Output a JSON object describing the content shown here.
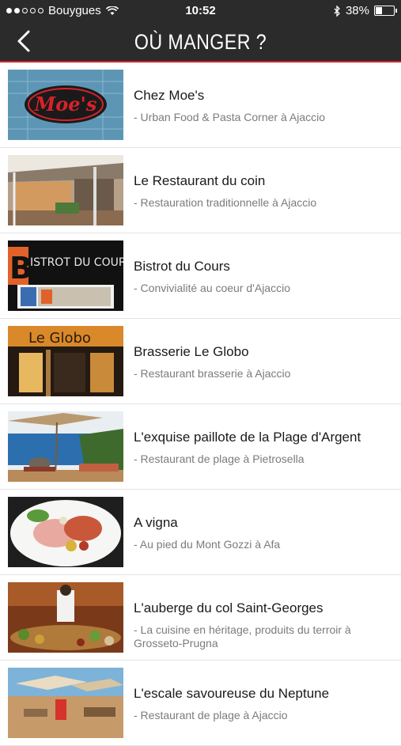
{
  "status": {
    "carrier": "Bouygues",
    "time": "10:52",
    "battery": "38%",
    "battery_level": 0.38
  },
  "nav": {
    "title": "OÙ MANGER ?",
    "back_icon": "chevron-left-icon"
  },
  "restaurants": [
    {
      "name": "Chez Moe's",
      "subtitle": " - Urban Food & Pasta Corner à Ajaccio",
      "logo_text": "Moe's"
    },
    {
      "name": "Le Restaurant du coin",
      "subtitle": " - Restauration traditionnelle à Ajaccio"
    },
    {
      "name": "Bistrot du Cours",
      "subtitle": " - Convivialité au coeur d'Ajaccio",
      "logo_text": "ISTROT DU COURS"
    },
    {
      "name": "Brasserie Le Globo",
      "subtitle": " - Restaurant brasserie à Ajaccio",
      "logo_text": "Le Globo"
    },
    {
      "name": "L'exquise paillote de la Plage d'Argent",
      "subtitle": " - Restaurant de plage à Pietrosella"
    },
    {
      "name": "A vigna",
      "subtitle": " - Au pied du Mont Gozzi à Afa"
    },
    {
      "name": "L'auberge du col Saint-Georges",
      "subtitle": " - La cuisine en héritage, produits du terroir à Grosseto-Prugna"
    },
    {
      "name": "L'escale savoureuse du Neptune",
      "subtitle": " - Restaurant de plage à Ajaccio"
    }
  ]
}
